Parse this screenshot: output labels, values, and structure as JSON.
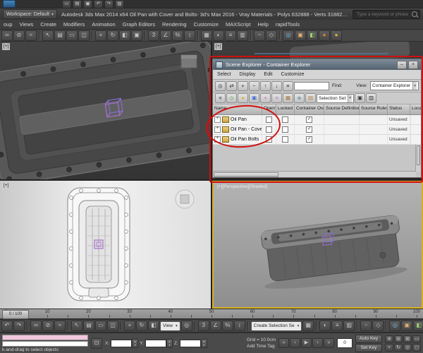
{
  "colors": {
    "annotation_red": "#d01010",
    "active_viewport_yellow": "#d8b021",
    "gizmo_purple": "#a86fd4"
  },
  "ui": {
    "caret_glyph": "▾",
    "check_glyph": "✓",
    "expander_glyph": "+",
    "lock_icon_glyph": "⊡"
  },
  "app": {
    "workspace_label": "Workspace: Default",
    "title": "Autodesk 3ds Max  2014 x64   Oil Pan with Cover and Bolts- 3d's Max 2016 - Vray Materials - Polys 632888 - Verts 318828.max",
    "search_placeholder": "Type a keyword or phrase",
    "qat_icons": [
      {
        "name": "new-scene-icon",
        "glyph": "▭"
      },
      {
        "name": "open-file-icon",
        "glyph": "▤"
      },
      {
        "name": "save-file-icon",
        "glyph": "▣"
      },
      {
        "name": "undo-icon",
        "glyph": "↶"
      },
      {
        "name": "redo-icon",
        "glyph": "↷"
      },
      {
        "name": "project-folder-icon",
        "glyph": "▧"
      }
    ]
  },
  "menu_bar": {
    "items": [
      "oup",
      "Views",
      "Create",
      "Modifiers",
      "Animation",
      "Graph Editors",
      "Rendering",
      "Customize",
      "MAXScript",
      "Help",
      "rapidTools"
    ]
  },
  "toolbars": {
    "top": [
      {
        "name": "select-and-link-icon",
        "glyph": "∞"
      },
      {
        "name": "unlink-selection-icon",
        "glyph": "⊘"
      },
      {
        "name": "bind-to-space-warp-icon",
        "glyph": "≈"
      },
      {
        "type": "sep"
      },
      {
        "name": "select-object-icon",
        "glyph": "↖"
      },
      {
        "name": "select-by-name-icon",
        "glyph": "▤"
      },
      {
        "name": "rectangular-selection-icon",
        "glyph": "▭"
      },
      {
        "name": "window-crossing-icon",
        "glyph": "◫"
      },
      {
        "type": "sep"
      },
      {
        "name": "select-and-move-icon",
        "glyph": "+"
      },
      {
        "name": "select-and-rotate-icon",
        "glyph": "↻"
      },
      {
        "name": "select-and-scale-icon",
        "glyph": "◧"
      },
      {
        "name": "select-and-manipulate-icon",
        "glyph": "▣"
      },
      {
        "type": "sep"
      },
      {
        "name": "snaps-toggle-icon",
        "glyph": "3"
      },
      {
        "name": "angle-snap-icon",
        "glyph": "∠"
      },
      {
        "name": "percent-snap-icon",
        "glyph": "%"
      },
      {
        "name": "spinner-snap-icon",
        "glyph": "↕"
      },
      {
        "type": "sep"
      },
      {
        "name": "edit-named-selection-sets-icon",
        "glyph": "▦"
      },
      {
        "name": "mirror-icon",
        "glyph": "◐"
      },
      {
        "name": "align-icon",
        "glyph": "≡"
      },
      {
        "name": "layer-manager-icon",
        "glyph": "▥"
      },
      {
        "type": "sep"
      },
      {
        "name": "curve-editor-icon",
        "glyph": "~"
      },
      {
        "name": "schematic-view-icon",
        "glyph": "◇"
      },
      {
        "type": "sep"
      },
      {
        "name": "material-editor-icon",
        "glyph": "◎",
        "color": "#6fb8e8"
      },
      {
        "name": "render-setup-icon",
        "glyph": "▣",
        "color": "#e8b06f"
      },
      {
        "name": "rendered-frame-window-icon",
        "glyph": "◧",
        "color": "#9fd06f"
      },
      {
        "name": "render-production-icon",
        "glyph": "●",
        "color": "#e8832a"
      },
      {
        "name": "render-iterative-icon",
        "glyph": "●",
        "color": "#d8b93a"
      }
    ],
    "bottom": [
      {
        "name": "undo-icon",
        "glyph": "↶"
      },
      {
        "name": "redo-icon",
        "glyph": "↷"
      },
      {
        "type": "sep"
      },
      {
        "name": "select-and-link-icon",
        "glyph": "∞"
      },
      {
        "name": "unlink-selection-icon",
        "glyph": "⊘"
      },
      {
        "name": "bind-to-space-warp-icon",
        "glyph": "≈"
      },
      {
        "type": "sep"
      },
      {
        "name": "select-object-icon",
        "glyph": "↖"
      },
      {
        "name": "select-by-name-icon",
        "glyph": "▤"
      },
      {
        "name": "rectangular-selection-icon",
        "glyph": "▭"
      },
      {
        "name": "window-crossing-icon",
        "glyph": "◫"
      },
      {
        "type": "sep"
      },
      {
        "name": "select-and-move-icon",
        "glyph": "+"
      },
      {
        "name": "select-and-rotate-icon",
        "glyph": "↻"
      },
      {
        "name": "select-and-scale-icon",
        "glyph": "◧"
      },
      {
        "type": "select",
        "name": "reference-coordinate-system-dropdown",
        "label": "View"
      },
      {
        "name": "use-pivot-point-icon",
        "glyph": "◎"
      },
      {
        "type": "sep"
      },
      {
        "name": "snaps-toggle-icon",
        "glyph": "3"
      },
      {
        "name": "angle-snap-icon",
        "glyph": "∠"
      },
      {
        "name": "percent-snap-icon",
        "glyph": "%"
      },
      {
        "name": "spinner-snap-icon",
        "glyph": "↕"
      },
      {
        "type": "sep"
      },
      {
        "type": "select",
        "name": "named-selection-sets-dropdown",
        "label": "Create Selection Se"
      },
      {
        "name": "edit-named-selection-sets-icon",
        "glyph": "▦"
      },
      {
        "type": "sep"
      },
      {
        "name": "mirror-icon",
        "glyph": "◐"
      },
      {
        "name": "align-icon",
        "glyph": "≡"
      },
      {
        "name": "layer-manager-icon",
        "glyph": "▥"
      },
      {
        "type": "sep"
      },
      {
        "name": "curve-editor-icon",
        "glyph": "~"
      },
      {
        "name": "schematic-view-icon",
        "glyph": "◇"
      },
      {
        "type": "sep"
      },
      {
        "name": "material-editor-icon",
        "glyph": "◎",
        "color": "#6fb8e8"
      },
      {
        "name": "render-setup-icon",
        "glyph": "▣",
        "color": "#e8b06f"
      },
      {
        "name": "rendered-frame-window-icon",
        "glyph": "◧",
        "color": "#9fd06f"
      },
      {
        "name": "render-production-icon",
        "glyph": "●",
        "color": "#e8832a"
      },
      {
        "name": "render-iterative-icon",
        "glyph": "●",
        "color": "#d8b93a"
      }
    ]
  },
  "explorer": {
    "title": "Scene Explorer - Container Explorer",
    "window_buttons": [
      {
        "name": "minimize-button",
        "glyph": "–"
      },
      {
        "name": "close-button",
        "glyph": "×"
      }
    ],
    "menus": [
      "Select",
      "Display",
      "Edit",
      "Customize"
    ],
    "icons1": [
      {
        "name": "find-select-icon",
        "glyph": "◎"
      },
      {
        "name": "sync-selection-icon",
        "glyph": "⇄"
      },
      {
        "name": "expand-all-icon",
        "glyph": "+"
      },
      {
        "name": "collapse-all-icon",
        "glyph": "−"
      },
      {
        "name": "pick-parent-icon",
        "glyph": "↑"
      },
      {
        "name": "pick-children-icon",
        "glyph": "↓"
      },
      {
        "name": "explorer-settings-icon",
        "glyph": "≡"
      }
    ],
    "find_label": "Find:",
    "find_value": "",
    "view_label": "View:",
    "view_value": "Container Explorer",
    "icons2a": [
      {
        "name": "display-geometry-icon",
        "glyph": "■",
        "color": "#8c8c8c"
      },
      {
        "name": "display-shapes-icon",
        "glyph": "◇",
        "color": "#3f9e3f"
      },
      {
        "name": "display-lights-icon",
        "glyph": "●",
        "color": "#d8b930"
      },
      {
        "name": "display-cameras-icon",
        "glyph": "▣",
        "color": "#3f6ed0"
      },
      {
        "name": "display-helpers-icon",
        "glyph": "+",
        "color": "#c85fa8"
      },
      {
        "name": "display-space-warps-icon",
        "glyph": "≈",
        "color": "#8f5fd0"
      },
      {
        "name": "display-groups-icon",
        "glyph": "▦",
        "color": "#a07838"
      },
      {
        "name": "display-xrefs-icon",
        "glyph": "◈",
        "color": "#5f9ea0"
      },
      {
        "name": "display-containers-icon",
        "glyph": "▤",
        "color": "#b08040"
      }
    ],
    "selection_set_value": "Selection Set",
    "icons2b": [
      {
        "name": "lock-cell-editing-icon",
        "glyph": "▣"
      },
      {
        "name": "column-chooser-icon",
        "glyph": "▥"
      }
    ],
    "columns": [
      "Name",
      "Open?",
      "Locked ...",
      "Container Ove...",
      "Source Definition",
      "Source Rules",
      "Status",
      "Local Defi"
    ],
    "rows": [
      {
        "name": "Oil Pan",
        "open": false,
        "locked": false,
        "override": true,
        "status": "Unsaved"
      },
      {
        "name": "Oil Pan - Cover",
        "open": false,
        "locked": false,
        "override": true,
        "status": "Unsaved"
      },
      {
        "name": "Oil Pan Bolts",
        "open": false,
        "locked": false,
        "override": true,
        "status": "Unsaved"
      }
    ]
  },
  "viewports": {
    "top_left": {
      "label": "[+]"
    },
    "top_right": {
      "label": "[+]"
    },
    "bottom_left": {
      "label": "[+]"
    },
    "bottom_right": {
      "label": "[+][Perspective][Shaded]"
    }
  },
  "timeline": {
    "min": 0,
    "max": 100,
    "minor_step": 5,
    "label_step": 10,
    "slider_label": "0 / 100"
  },
  "statusbar": {
    "prompt": "k-and-drag to select objects",
    "x_label": "X:",
    "y_label": "Y:",
    "z_label": "Z:",
    "coord_x": "",
    "coord_y": "",
    "coord_z": "",
    "grid_label": "Grid = 10.0cm",
    "add_time_tag": "Add Time Tag",
    "frame_value": "0",
    "auto_key_label": "Auto Key",
    "set_key_label": "Set Key",
    "playback": [
      {
        "name": "go-to-start-icon",
        "glyph": "«"
      },
      {
        "name": "previous-frame-icon",
        "glyph": "‹"
      },
      {
        "name": "play-animation-icon",
        "glyph": "▶"
      },
      {
        "name": "next-frame-icon",
        "glyph": "›"
      },
      {
        "name": "go-to-end-icon",
        "glyph": "»"
      }
    ],
    "nav_icons": [
      {
        "name": "zoom-icon",
        "glyph": "⊕"
      },
      {
        "name": "zoom-all-icon",
        "glyph": "⊞"
      },
      {
        "name": "zoom-extents-icon",
        "glyph": "⊠"
      },
      {
        "name": "zoom-region-icon",
        "glyph": "▭"
      },
      {
        "name": "pan-view-icon",
        "glyph": "+"
      },
      {
        "name": "orbit-icon",
        "glyph": "↻"
      },
      {
        "name": "field-of-view-icon",
        "glyph": "◎"
      },
      {
        "name": "maximize-viewport-icon",
        "glyph": "◻"
      }
    ]
  }
}
